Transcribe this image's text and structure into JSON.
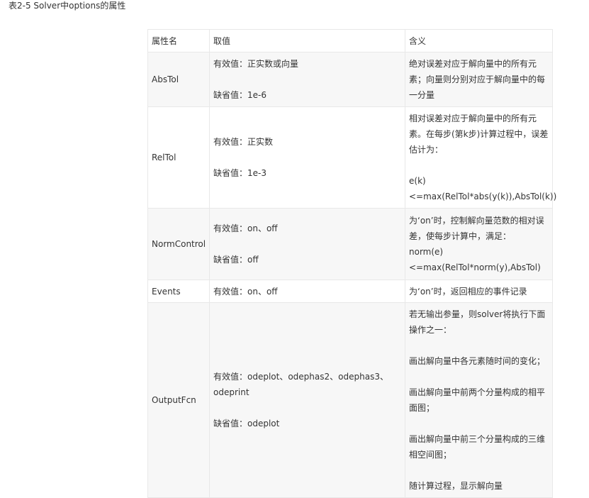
{
  "caption": "表2-5  Solver中options的属性",
  "headers": [
    "属性名",
    "取值",
    "含义"
  ],
  "rows": [
    {
      "name": "AbsTol",
      "value": "有效值：正实数或向量\n\n缺省值：1e-6",
      "meaning": "绝对误差对应于解向量中的所有元素；向量则分别对应于解向量中的每一分量"
    },
    {
      "name": "RelTol",
      "value": "有效值：正实数\n\n缺省值：1e-3",
      "meaning": "相对误差对应于解向量中的所有元素。在每步(第k步)计算过程中，误差估计为：\n\ne(k)\n<=max(RelTol*abs(y(k)),AbsTol(k))"
    },
    {
      "name": "NormControl",
      "value": "有效值：on、off\n\n缺省值：off",
      "meaning": "为‘on’时，控制解向量范数的相对误差，使每步计算中，满足：\nnorm(e)\n<=max(RelTol*norm(y),AbsTol)"
    },
    {
      "name": "Events",
      "value": "有效值：on、off",
      "meaning": "为‘on’时，返回相应的事件记录"
    },
    {
      "name": "OutputFcn",
      "value": "有效值：odeplot、odephas2、odephas3、odeprint\n\n缺省值：odeplot",
      "meaning": "若无输出参量，则solver将执行下面操作之一：\n\n画出解向量中各元素随时间的变化；\n\n画出解向量中前两个分量构成的相平面图；\n\n画出解向量中前三个分量构成的三维相空间图；\n\n随计算过程，显示解向量"
    }
  ]
}
